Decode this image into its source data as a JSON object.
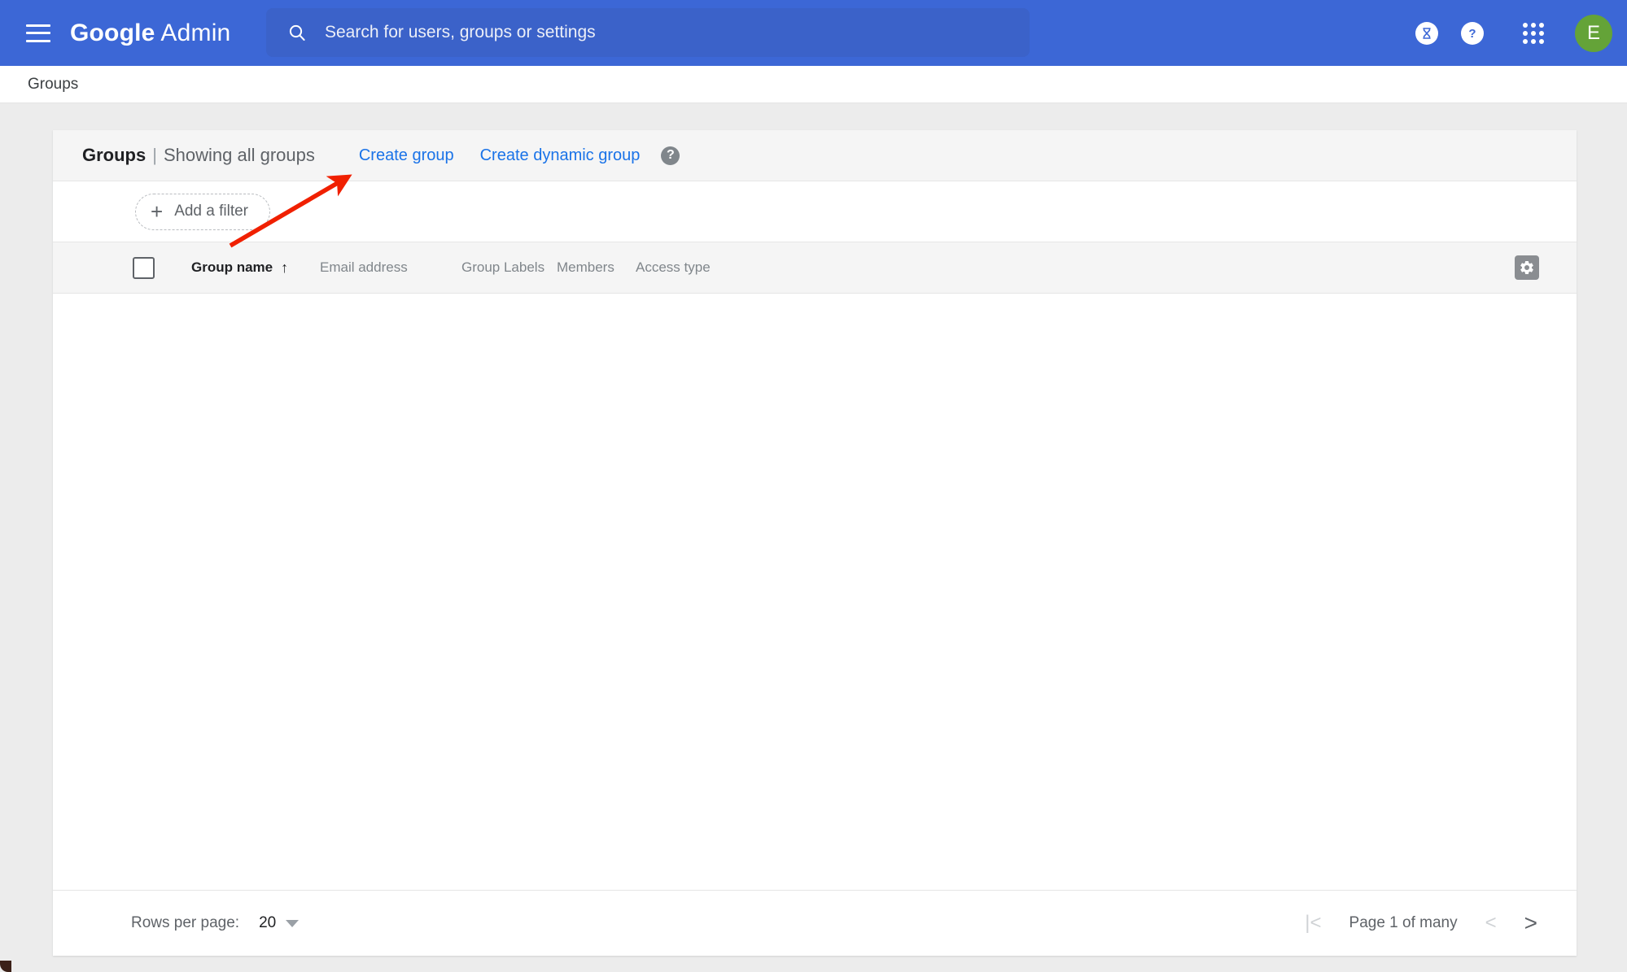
{
  "appbar": {
    "menu_icon": "hamburger-menu-icon",
    "brand_strong": "Google",
    "brand_light": " Admin",
    "search": {
      "icon": "search-icon",
      "placeholder": "Search for users, groups or settings",
      "value": ""
    },
    "trial_icon": "hourglass-icon",
    "help_icon": "help-question-icon",
    "apps_icon": "apps-grid-icon",
    "avatar_initial": "E",
    "colors": {
      "bar": "#3c67d6",
      "search_field": "#3b62c9",
      "avatar": "#64a338"
    }
  },
  "breadcrumb": {
    "current": "Groups"
  },
  "card": {
    "title": "Groups",
    "title_separator": "|",
    "subtitle": "Showing all groups",
    "actions": [
      {
        "label": "Create group",
        "name": "create-group-link"
      },
      {
        "label": "Create dynamic group",
        "name": "create-dynamic-group-link"
      }
    ],
    "help_badge": "?",
    "filter": {
      "plus": "+",
      "label": "Add a filter"
    },
    "table": {
      "columns": [
        {
          "label": "Group name",
          "sorted": true,
          "sort_arrow": "↑"
        },
        {
          "label": "Email address",
          "sorted": false
        },
        {
          "label": "Group Labels",
          "sorted": false
        },
        {
          "label": "Members",
          "sorted": false
        },
        {
          "label": "Access type",
          "sorted": false
        }
      ],
      "settings_icon": "column-settings-gear-icon",
      "rows": []
    },
    "footer": {
      "rows_per_page_label": "Rows per page:",
      "rows_per_page_value": "20",
      "first_page_icon": "|<",
      "page_label": "Page 1 of many",
      "prev_page_icon": "<",
      "next_page_icon": ">"
    }
  },
  "annotation": {
    "type": "arrow",
    "color": "#f02000",
    "points_to": "create-group-link"
  }
}
